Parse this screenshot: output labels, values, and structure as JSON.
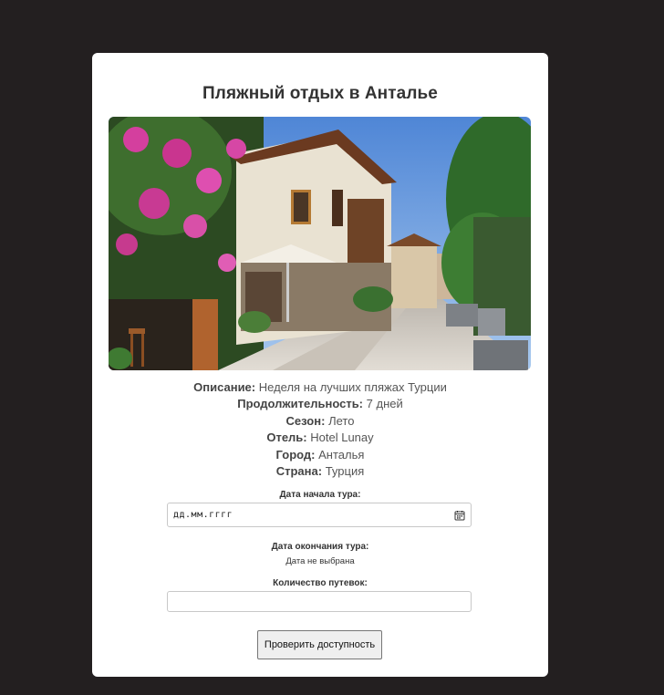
{
  "tour": {
    "title": "Пляжный отдых в Анталье",
    "image_alt": "Улица старого города Антальи с цветами и домами",
    "details": [
      {
        "label": "Описание:",
        "value": "Неделя на лучших пляжах Турции"
      },
      {
        "label": "Продолжительность:",
        "value": "7 дней"
      },
      {
        "label": "Сезон:",
        "value": "Лето"
      },
      {
        "label": "Отель:",
        "value": "Hotel Lunay"
      },
      {
        "label": "Город:",
        "value": "Анталья"
      },
      {
        "label": "Страна:",
        "value": "Турция"
      }
    ]
  },
  "form": {
    "start_date_label": "Дата начала тура:",
    "start_date_placeholder": "дд.мм.гггг",
    "end_date_label": "Дата окончания тура:",
    "end_date_value": "Дата не выбрана",
    "quantity_label": "Количество путевок:",
    "quantity_value": "",
    "submit_label": "Проверить доступность"
  },
  "icons": {
    "calendar": "calendar-icon"
  },
  "colors": {
    "page_background": "#231f20",
    "card_background": "#ffffff",
    "title_text": "#333333"
  }
}
